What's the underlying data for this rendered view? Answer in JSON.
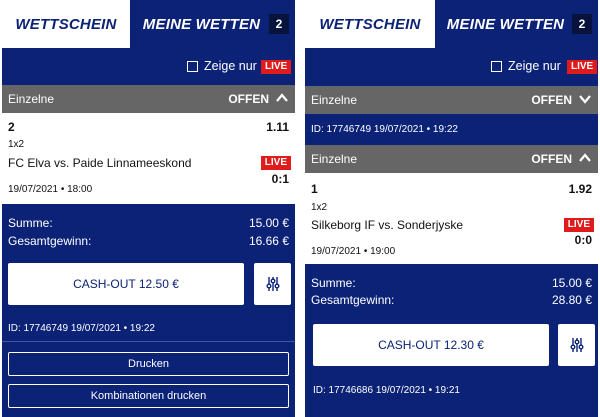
{
  "left": {
    "tabs": {
      "active": "WETTSCHEIN",
      "inactive": "MEINE WETTEN",
      "badge": "2"
    },
    "live_filter": {
      "label": "Zeige nur",
      "tag": "LIVE"
    },
    "section": {
      "title": "Einzelne",
      "status": "OFFEN",
      "icon": "chevron-up-icon"
    },
    "bet": {
      "selection": "2",
      "odds": "1.11",
      "market": "1x2",
      "match": "FC Elva vs. Paide Linnameeskond",
      "live_tag": "LIVE",
      "score": "0:1",
      "datetime": "19/07/2021 • 18:00"
    },
    "summary": {
      "stake_label": "Summe:",
      "stake": "15.00 €",
      "win_label": "Gesamtgewinn:",
      "win": "16.66 €"
    },
    "cashout_label": "CASH-OUT 12.50 €",
    "bet_id": "ID: 17746749  19/07/2021 • 19:22",
    "print_label": "Drucken",
    "print_combo_label": "Kombinationen drucken"
  },
  "right": {
    "tabs": {
      "active": "WETTSCHEIN",
      "inactive": "MEINE WETTEN",
      "badge": "2"
    },
    "live_filter": {
      "label": "Zeige nur",
      "tag": "LIVE"
    },
    "collapsed_section": {
      "title": "Einzelne",
      "status": "OFFEN",
      "icon": "chevron-down-icon"
    },
    "collapsed_id": "ID: 17746749  19/07/2021 • 19:22",
    "section": {
      "title": "Einzelne",
      "status": "OFFEN",
      "icon": "chevron-up-icon"
    },
    "bet": {
      "selection": "1",
      "odds": "1.92",
      "market": "1x2",
      "match": "Silkeborg IF vs. Sonderjyske",
      "live_tag": "LIVE",
      "score": "0:0",
      "datetime": "19/07/2021 • 19:00"
    },
    "summary": {
      "stake_label": "Summe:",
      "stake": "15.00 €",
      "win_label": "Gesamtgewinn:",
      "win": "28.80 €"
    },
    "cashout_label": "CASH-OUT 12.30 €",
    "bet_id": "ID: 17746686  19/07/2021 • 19:21"
  },
  "colors": {
    "brand": "#0b2277",
    "live": "#e01b1b",
    "section_header": "#666666"
  }
}
